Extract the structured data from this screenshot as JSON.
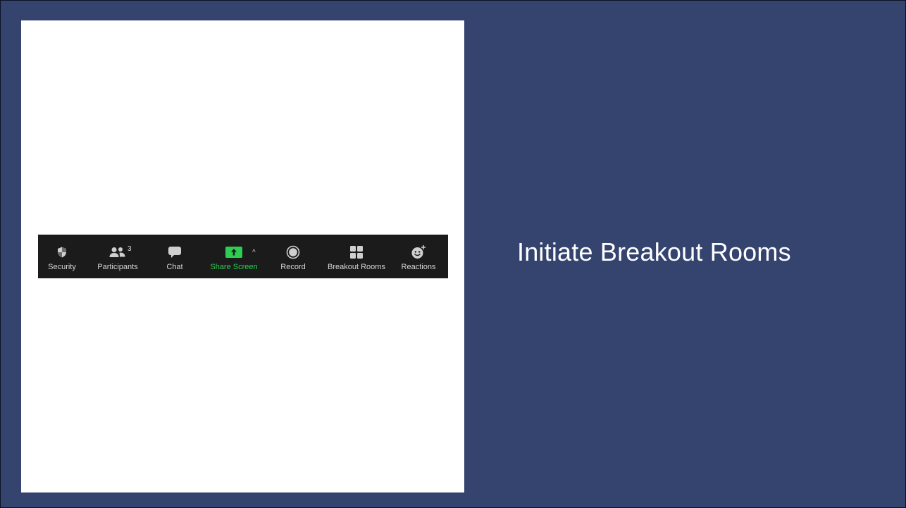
{
  "slide": {
    "title": "Initiate Breakout Rooms",
    "background_color": "#34446f",
    "panel_color": "#ffffff"
  },
  "toolbar": {
    "background_color": "#1b1b1b",
    "accent_color": "#2ecc51",
    "items": [
      {
        "label": "Security",
        "icon": "shield-icon"
      },
      {
        "label": "Participants",
        "icon": "participants-icon",
        "count": "3"
      },
      {
        "label": "Chat",
        "icon": "chat-icon"
      },
      {
        "label": "Share Screen",
        "icon": "share-screen-icon",
        "caret": "^"
      },
      {
        "label": "Record",
        "icon": "record-icon"
      },
      {
        "label": "Breakout Rooms",
        "icon": "breakout-rooms-icon"
      },
      {
        "label": "Reactions",
        "icon": "reactions-icon"
      }
    ]
  }
}
